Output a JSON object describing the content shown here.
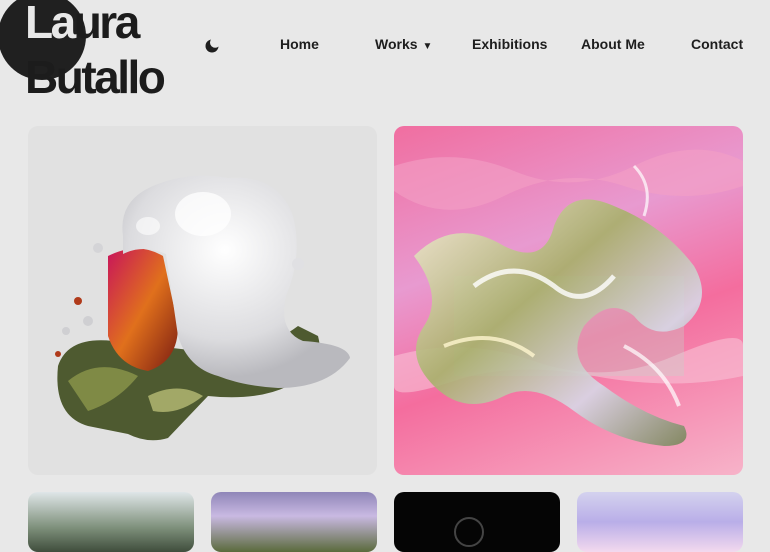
{
  "brand": {
    "name_line1": "Laura",
    "name_line2": "Butallo"
  },
  "nav": {
    "items": [
      {
        "label": "Home"
      },
      {
        "label": "Works",
        "has_dropdown": true
      },
      {
        "label": "Exhibitions"
      },
      {
        "label": "About Me"
      },
      {
        "label": "Contact"
      }
    ],
    "dropdown_caret": "▼"
  },
  "icons": {
    "theme_toggle": "moon-icon"
  },
  "colors": {
    "background": "#e8e8e8",
    "text": "#1e1e1e",
    "logo_circle": "#202020"
  },
  "gallery": {
    "featured": [
      {
        "name": "sculpture-white-liquid-artwork"
      },
      {
        "name": "iridescent-glass-abstract-artwork"
      }
    ],
    "thumbnails": [
      {
        "name": "forest-trees-artwork"
      },
      {
        "name": "purple-landscape-artwork"
      },
      {
        "name": "dark-artwork"
      },
      {
        "name": "lavender-glass-artwork"
      }
    ]
  }
}
